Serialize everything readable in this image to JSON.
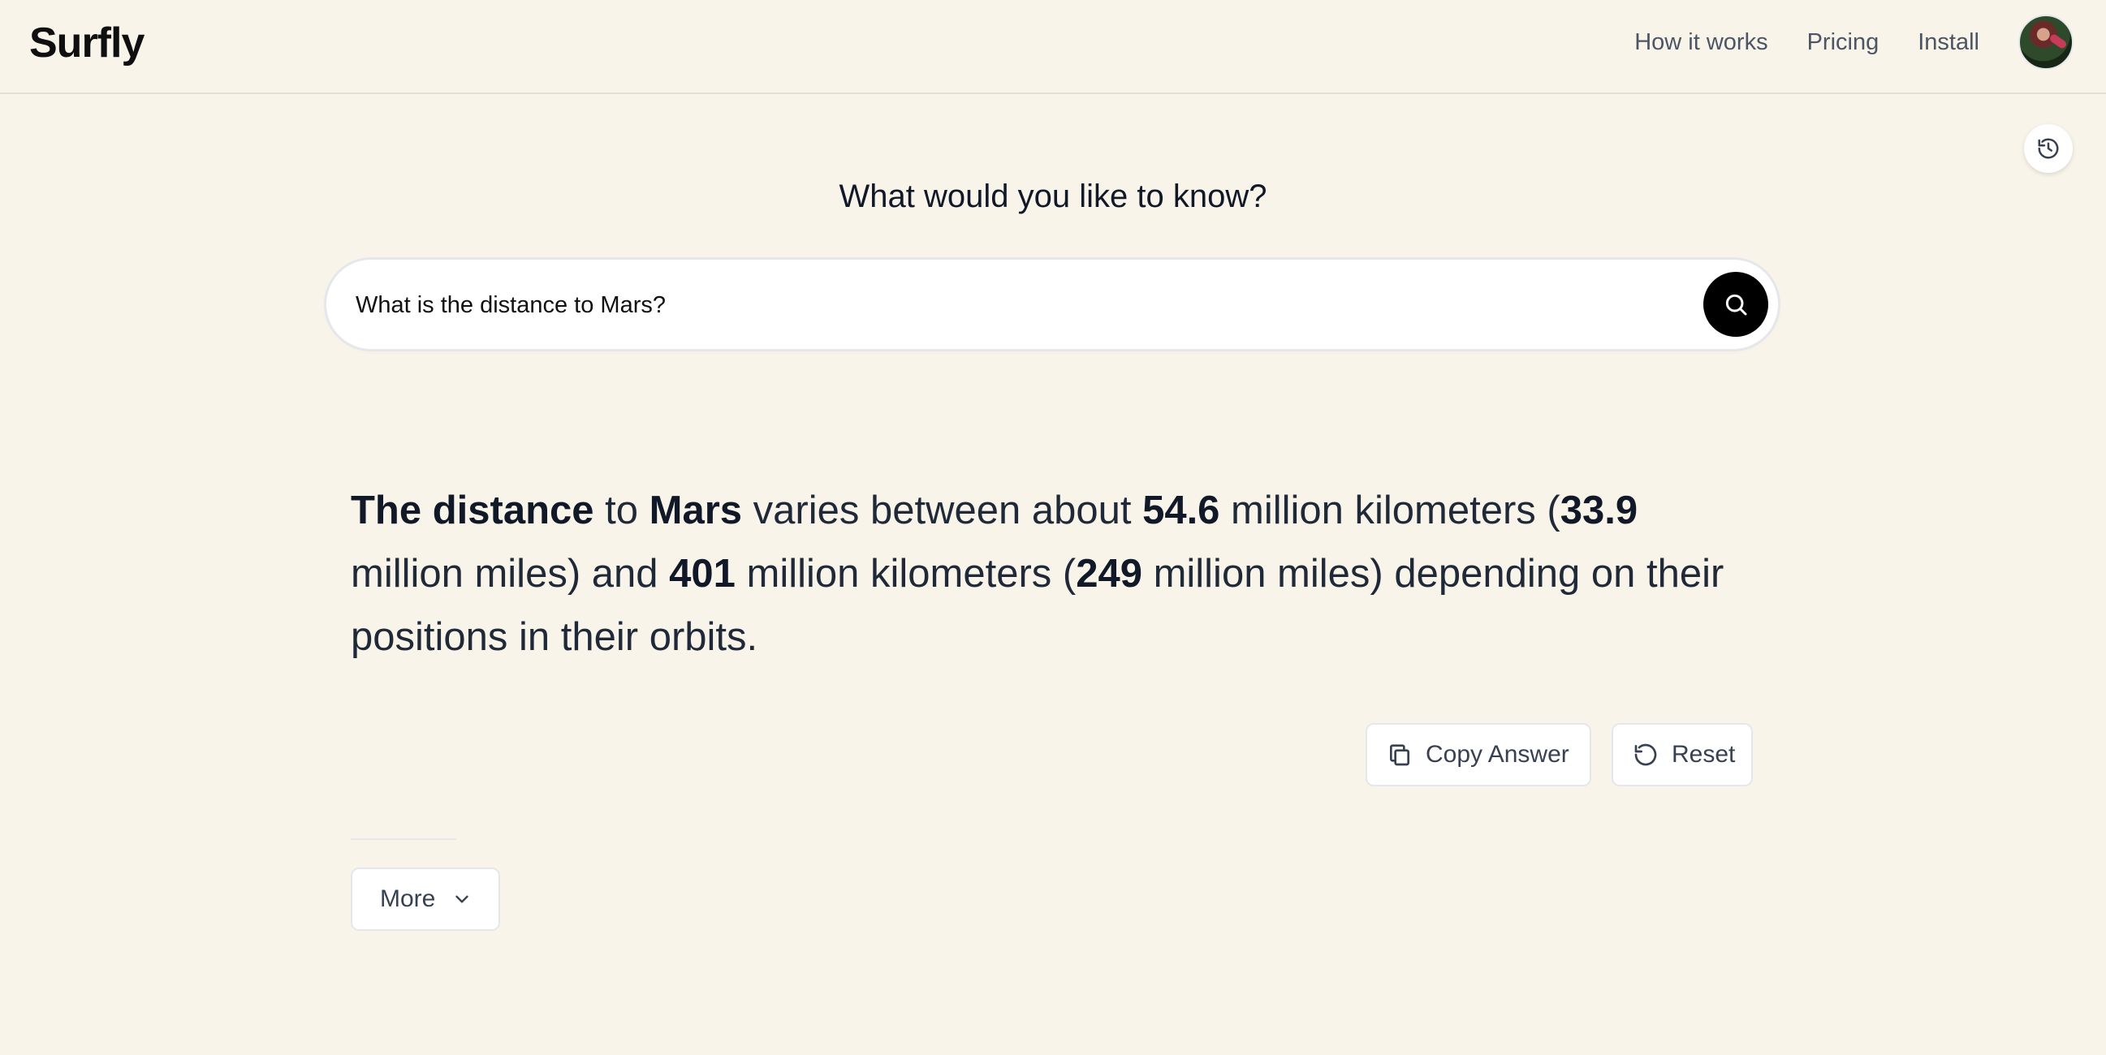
{
  "header": {
    "logo": "Surfly",
    "nav": [
      {
        "label": "How it works"
      },
      {
        "label": "Pricing"
      },
      {
        "label": "Install"
      }
    ]
  },
  "main": {
    "title": "What would you like to know?",
    "search": {
      "value": "What is the distance to Mars?",
      "placeholder": ""
    },
    "answer": {
      "parts": [
        "The distance",
        " to ",
        "Mars",
        " varies between about ",
        "54.6",
        " million kilometers (",
        "33.9",
        " million miles) and ",
        "401",
        " million kilometers (",
        "249",
        " million miles) depending on their positions in their orbits."
      ]
    },
    "actions": {
      "copy_label": "Copy Answer",
      "reset_label": "Reset",
      "more_label": "More"
    }
  },
  "icons": {
    "history": "history-icon",
    "search": "search-icon",
    "copy": "copy-icon",
    "reset": "reset-icon",
    "more": "chevron-down-icon"
  },
  "colors": {
    "background": "#f8f4ea",
    "search_button": "#000000",
    "text_primary": "#111827",
    "nav_text": "#4b5563"
  }
}
